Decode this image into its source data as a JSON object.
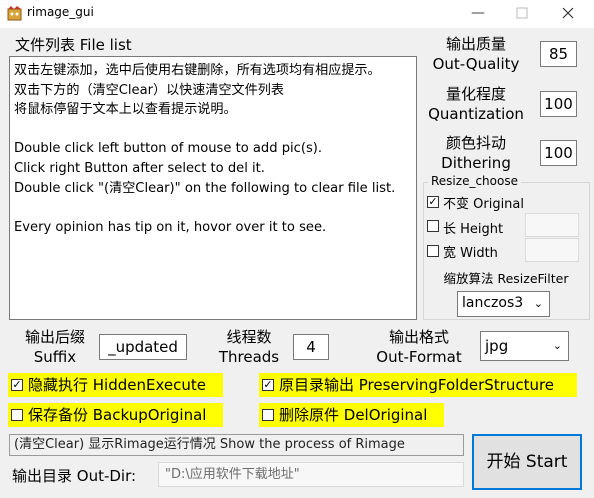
{
  "window": {
    "title": "rimage_gui",
    "icon": "rimage-app-icon",
    "controls": [
      "minimize",
      "maximize",
      "close"
    ]
  },
  "file_list": {
    "label": "文件列表 File list",
    "lines": [
      "双击左键添加，选中后使用右键删除，所有选项均有相应提示。",
      "双击下方的（清空Clear）以快速清空文件列表",
      "将鼠标停留于文本上以查看提示说明。",
      "",
      "Double click left button of mouse to add pic(s).",
      "Click right Button after select to del it.",
      "Double click \"(清空Clear)\" on the following to clear file list.",
      "",
      "Every opinion has tip on it, hovor over it to see."
    ]
  },
  "quality": {
    "label_cn": "输出质量",
    "label_en": "Out-Quality",
    "value": "85"
  },
  "quantization": {
    "label_cn": "量化程度",
    "label_en": "Quantization",
    "value": "100"
  },
  "dithering": {
    "label_cn": "颜色抖动",
    "label_en": "Dithering",
    "value": "100"
  },
  "resize": {
    "group_title": "Resize_choose",
    "original": {
      "label": "不变 Original",
      "checked": true
    },
    "height": {
      "label": "长 Height",
      "checked": false,
      "value": ""
    },
    "width": {
      "label": "宽 Width",
      "checked": false,
      "value": ""
    },
    "filter_label": "缩放算法 ResizeFilter",
    "filter_value": "lanczos3"
  },
  "suffix": {
    "label_cn": "输出后缀",
    "label_en": "Suffix",
    "value": "_updated"
  },
  "threads": {
    "label_cn": "线程数",
    "label_en": "Threads",
    "value": "4"
  },
  "format": {
    "label_cn": "输出格式",
    "label_en": "Out-Format",
    "value": "jpg"
  },
  "options": {
    "hidden_execute": {
      "label": "隐藏执行 HiddenExecute",
      "checked": true
    },
    "preserve_folder": {
      "label": "原目录输出 PreservingFolderStructure",
      "checked": true
    },
    "backup_original": {
      "label": "保存备份 BackupOriginal",
      "checked": false
    },
    "del_original": {
      "label": "删除原件 DelOriginal",
      "checked": false
    }
  },
  "status": {
    "text": "(清空Clear) 显示Rimage运行情况 Show the process of Rimage"
  },
  "outdir": {
    "label": "输出目录 Out-Dir:",
    "value": "\"D:\\应用软件下载地址\""
  },
  "start_button": {
    "label": "开始 Start"
  },
  "colors": {
    "highlight": "#ffff00",
    "focus_border": "#0078d7",
    "background": "#f0f0f0"
  }
}
